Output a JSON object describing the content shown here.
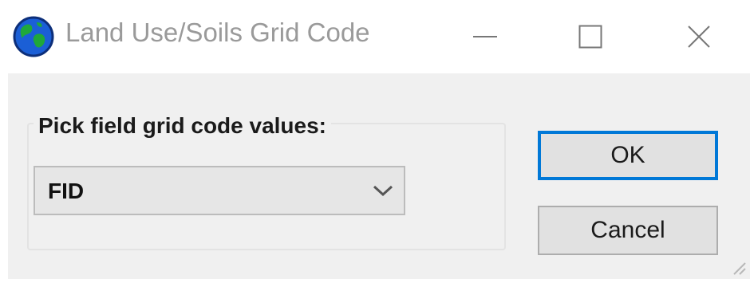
{
  "window": {
    "title": "Land Use/Soils Grid Code",
    "app_icon": "globe-icon",
    "controls": {
      "minimize": "minimize-icon",
      "maximize": "maximize-icon",
      "close": "close-icon"
    }
  },
  "form": {
    "group_label": "Pick field grid code values:",
    "field_select": {
      "selected": "FID",
      "icon": "chevron-down-icon"
    }
  },
  "buttons": {
    "ok_label": "OK",
    "cancel_label": "Cancel"
  },
  "colors": {
    "focus_border": "#0078d7",
    "client_background": "#f0f0f0",
    "title_text": "#9a9a9a"
  }
}
